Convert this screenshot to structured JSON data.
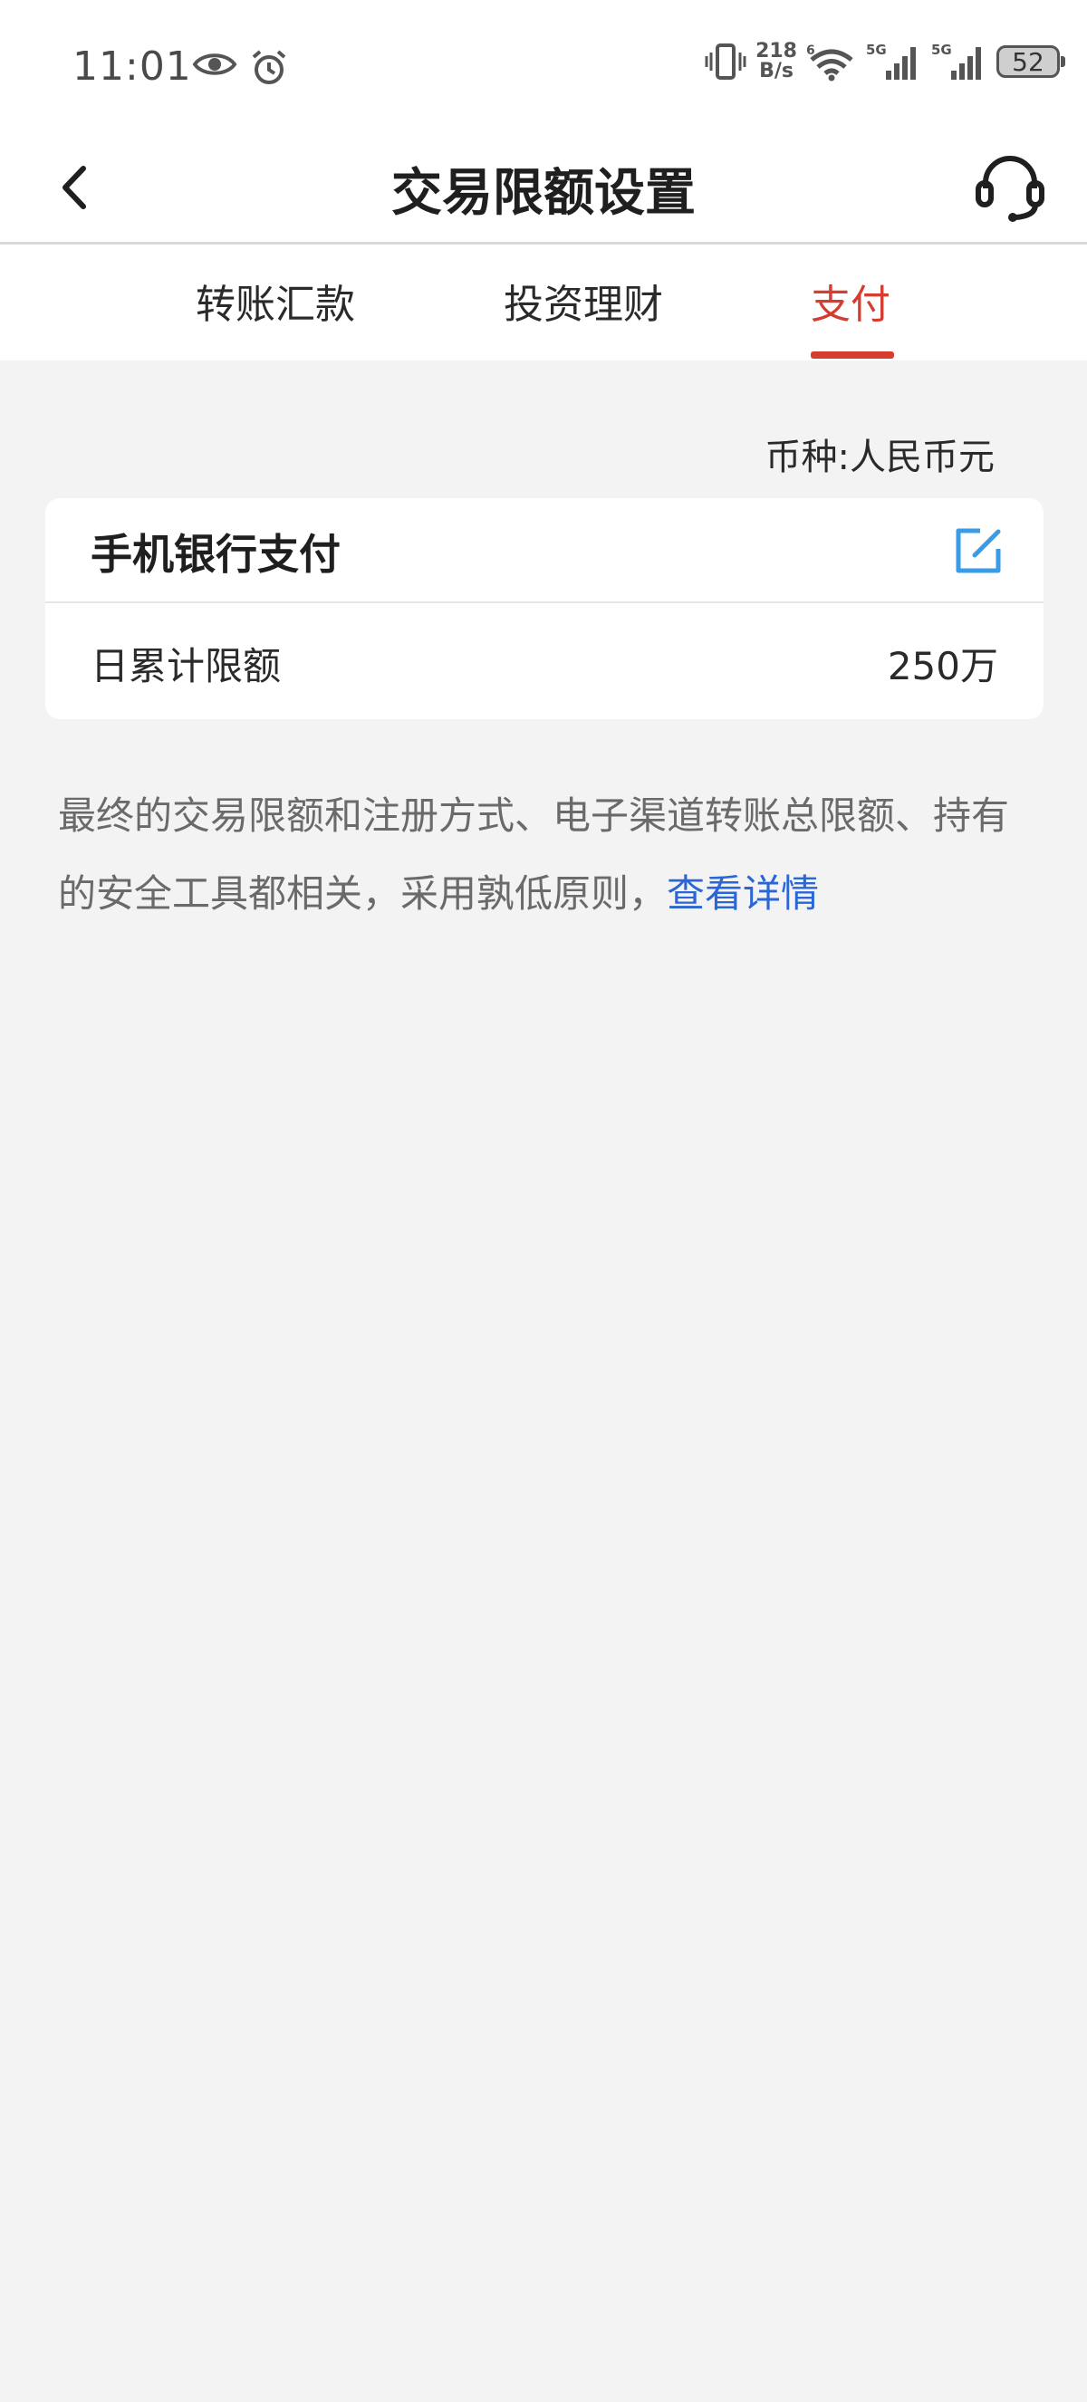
{
  "status_bar": {
    "time": "11:01",
    "net_speed_value": "218",
    "net_speed_unit": "B/s",
    "signal_1_label": "5G",
    "signal_2_label": "5G",
    "wifi_label": "6",
    "battery": "52"
  },
  "header": {
    "title": "交易限额设置"
  },
  "tabs": [
    {
      "label": "转账汇款"
    },
    {
      "label": "投资理财"
    },
    {
      "label": "支付"
    }
  ],
  "active_tab": "支付",
  "currency_label": "币种:人民币元",
  "card": {
    "title": "手机银行支付",
    "limit_label": "日累计限额",
    "limit_value": "250万"
  },
  "note": {
    "text": "最终的交易限额和注册方式、电子渠道转账总限额、持有的安全工具都相关，采用孰低原则，",
    "link": "查看详情"
  },
  "colors": {
    "accent": "#d43d30",
    "link": "#2a66d6",
    "edit_icon": "#3a9be6",
    "background": "#f3f3f3"
  }
}
